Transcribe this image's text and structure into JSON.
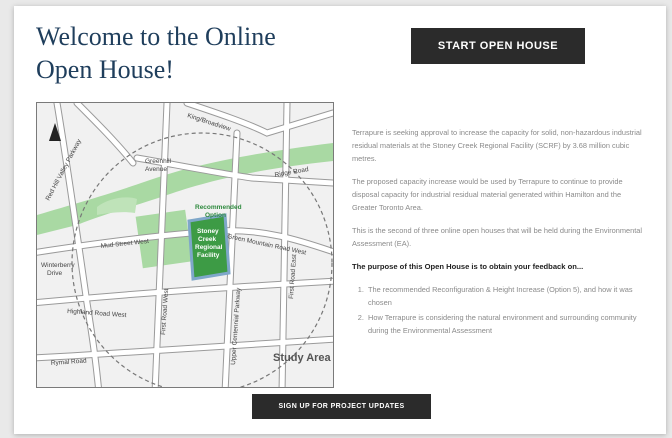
{
  "header": {
    "title_line1": "Welcome to the Online",
    "title_line2": "Open House!",
    "start_button": "START OPEN HOUSE"
  },
  "map": {
    "roads": {
      "kingsbury": "King/Broadview",
      "greenhill": "Greenhill",
      "greenhill2": "Avenue",
      "ridge": "Ridge Road",
      "redhill": "Red Hill Valley Parkway",
      "green_mountain": "Green Mountain Road West",
      "mud_street": "Mud Street West",
      "highland": "Highland Road West",
      "rymal": "Rymal Road",
      "first_road": "First Road West",
      "centennial": "Upper Centennial Parkway",
      "first_road_east": "First Road East",
      "winterberry": "Winterberry",
      "winterberry2": "Drive"
    },
    "recommended": [
      "Recommended",
      "Option"
    ],
    "site": [
      "Stoney",
      "Creek",
      "Regional",
      "Facility"
    ],
    "study_area": "Study Area",
    "north_icon": "north-arrow-icon",
    "colors": {
      "park": "#a9d9a3",
      "site": "#3d9b45",
      "road": "#ffffff",
      "outline": "#8a8a8a"
    }
  },
  "description": {
    "p1": "Terrapure is seeking approval to increase the capacity for solid, non-hazardous industrial residual materials at the Stoney Creek Regional Facility (SCRF) by 3.68 million cubic metres.",
    "p2": "The proposed capacity increase would be used by Terrapure to continue to provide disposal capacity for industrial residual material generated within Hamilton and the Greater Toronto Area.",
    "p3": "This is the second of three online open houses that will be held during the Environmental Assessment (EA).",
    "lead": "The purpose of this Open House is to obtain your feedback on...",
    "items": [
      "The recommended Reconfiguration & Height Increase (Option 5), and how it was chosen",
      "How Terrapure is considering the natural environment and surrounding community during the Environmental Assessment"
    ]
  },
  "footer": {
    "signup_button": "SIGN UP FOR PROJECT UPDATES"
  }
}
